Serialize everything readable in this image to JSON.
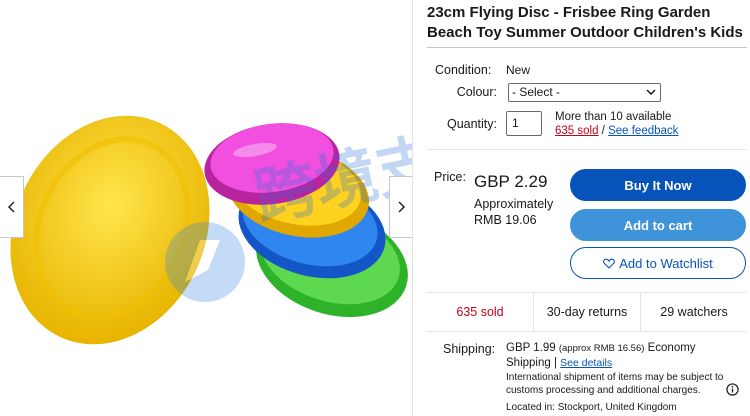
{
  "gallery": {
    "prev_icon": "chevron-left-icon",
    "next_icon": "chevron-right-icon",
    "watermark_text": "跨境支持"
  },
  "listing": {
    "title": "23cm Flying Disc - Frisbee Ring Garden Beach Toy Summer Outdoor Children's Kids"
  },
  "details": {
    "condition_label": "Condition:",
    "condition_value": "New",
    "colour_label": "Colour:",
    "colour_selected": "- Select -",
    "quantity_label": "Quantity:",
    "quantity_value": "1",
    "availability": "More than 10 available",
    "sold_link": "635 sold",
    "separator": " / ",
    "feedback_link": "See feedback"
  },
  "price": {
    "label": "Price:",
    "value": "GBP 2.29",
    "approx_line1": "Approximately",
    "approx_line2": "RMB 19.06"
  },
  "buttons": {
    "buy_now": "Buy It Now",
    "add_to_cart": "Add to cart",
    "watchlist": "Add to Watchlist"
  },
  "stats": {
    "sold": "635 sold",
    "returns": "30-day returns",
    "watchers": "29 watchers"
  },
  "shipping": {
    "label": "Shipping:",
    "cost": "GBP 1.99",
    "cost_approx": "(approx RMB 16.56)",
    "service_a": "Economy",
    "service_b": "Shipping",
    "see_details": "See details",
    "intl_note": "International shipment of items may be subject to customs processing and additional charges.",
    "located": "Located in: Stockport, United Kingdom"
  },
  "colors": {
    "brand_blue": "#0654ba",
    "cart_blue": "#3f93d8",
    "sold_red": "#c4001c",
    "disc_yellow": "#f5c400",
    "disc_magenta": "#e63fd6",
    "disc_blue": "#1c6ee0",
    "disc_green": "#3fc23a"
  }
}
